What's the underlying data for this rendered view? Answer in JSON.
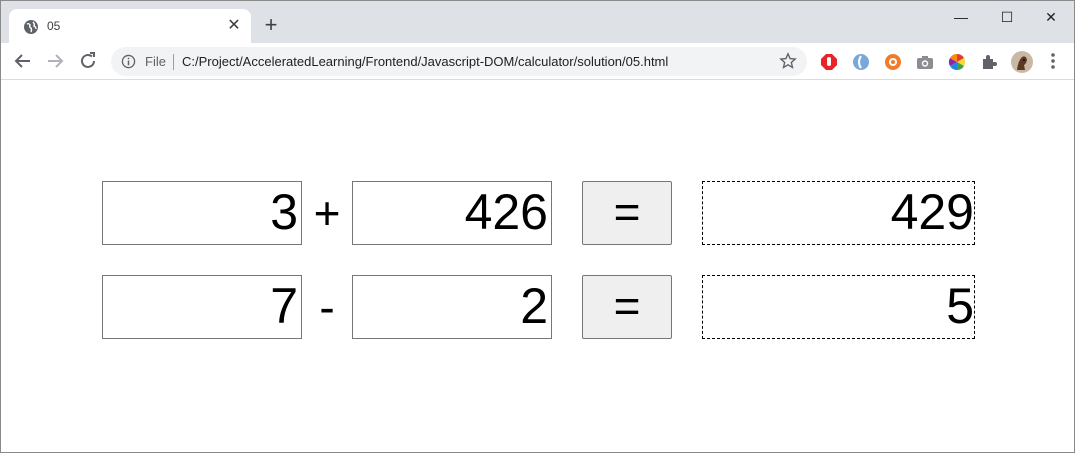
{
  "browser": {
    "tab_title": "05",
    "tab_close": "✕",
    "new_tab": "+",
    "window_controls": {
      "minimize": "—",
      "maximize": "☐",
      "close": "✕"
    },
    "scheme_label": "File",
    "url": "C:/Project/AcceleratedLearning/Frontend/Javascript-DOM/calculator/solution/05.html",
    "icons": [
      "globe-icon",
      "back-icon",
      "forward-icon",
      "reload-icon",
      "info-icon",
      "star-icon",
      "extension-icons",
      "menu-icon"
    ]
  },
  "calculator": {
    "rows": [
      {
        "left": "3",
        "operator": "+",
        "right": "426",
        "equals_label": "=",
        "result": "429"
      },
      {
        "left": "7",
        "operator": "-",
        "right": "2",
        "equals_label": "=",
        "result": "5"
      }
    ]
  }
}
